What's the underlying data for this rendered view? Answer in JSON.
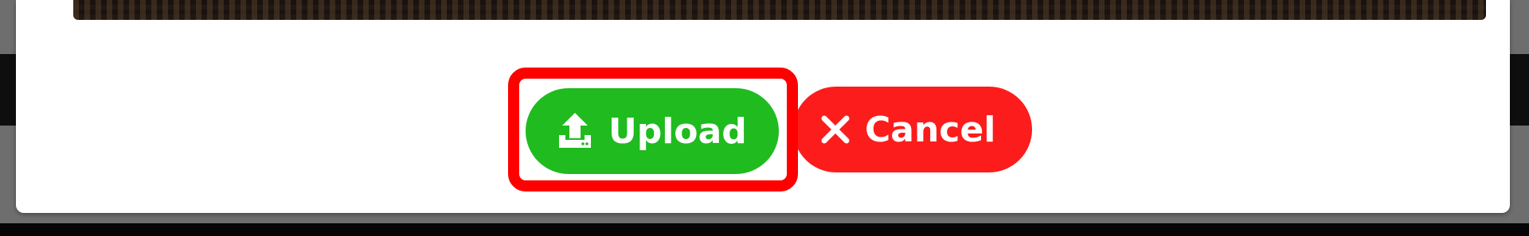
{
  "dialog": {
    "actions": {
      "upload": {
        "label": "Upload",
        "icon": "upload-icon",
        "color": "#1fbb1f"
      },
      "cancel": {
        "label": "Cancel",
        "icon": "close-icon",
        "color": "#fc1c1c"
      }
    },
    "highlight_color": "#ff0000"
  }
}
